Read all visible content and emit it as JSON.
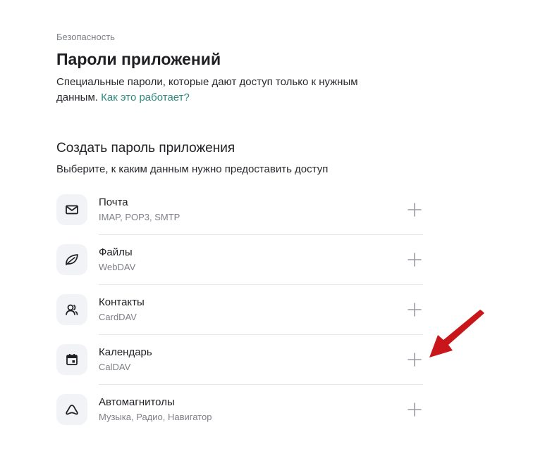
{
  "breadcrumb": "Безопасность",
  "title": "Пароли приложений",
  "description": {
    "text": "Специальные пароли, которые дают доступ только к нужным данным.",
    "link": "Как это работает?"
  },
  "section": {
    "title": "Создать пароль приложения",
    "subtitle": "Выберите, к каким данным нужно предоставить доступ"
  },
  "items": [
    {
      "label": "Почта",
      "sub": "IMAP, POP3, SMTP",
      "icon": "mail-icon"
    },
    {
      "label": "Файлы",
      "sub": "WebDAV",
      "icon": "leaf-icon"
    },
    {
      "label": "Контакты",
      "sub": "CardDAV",
      "icon": "contacts-icon"
    },
    {
      "label": "Календарь",
      "sub": "CalDAV",
      "icon": "calendar-icon"
    },
    {
      "label": "Автомагнитолы",
      "sub": "Музыка, Радио, Навигатор",
      "icon": "car-audio-icon"
    }
  ],
  "colors": {
    "link": "#2c8a7d",
    "icon_bg": "#f2f3f6",
    "annotation_arrow": "#c8161a"
  }
}
